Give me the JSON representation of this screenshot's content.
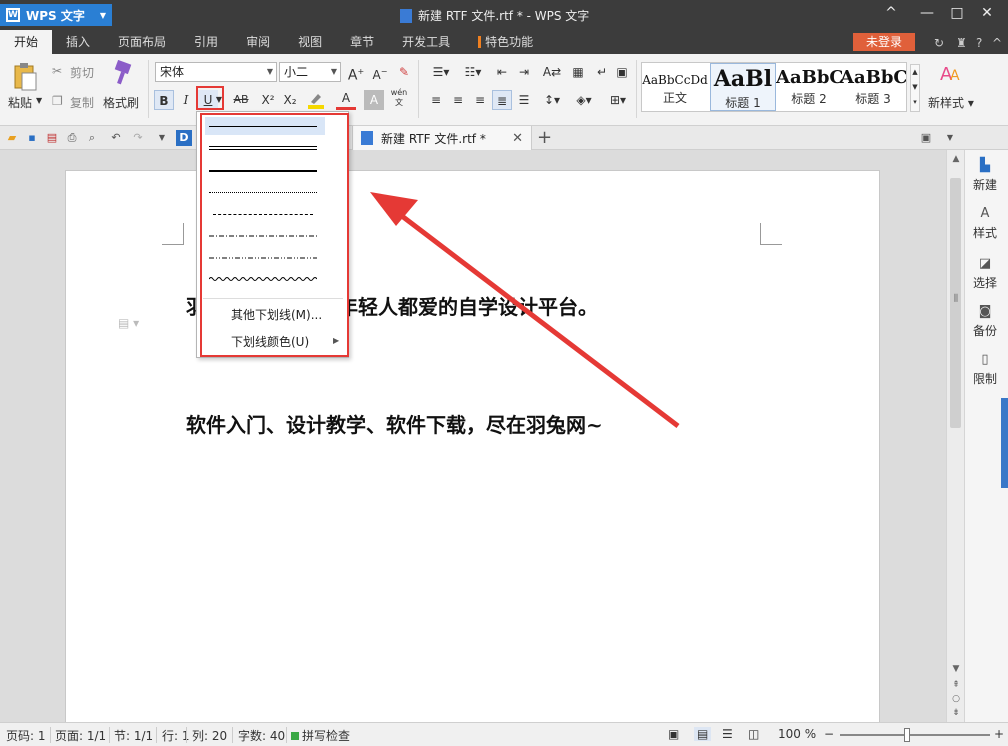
{
  "window": {
    "app_button": "WPS 文字",
    "title": "新建 RTF 文件.rtf * - WPS 文字",
    "controls": [
      "^",
      "—",
      "□",
      "✕"
    ]
  },
  "menu": {
    "items": [
      "开始",
      "插入",
      "页面布局",
      "引用",
      "审阅",
      "视图",
      "章节",
      "开发工具",
      "特色功能"
    ],
    "active": "开始",
    "login": "未登录"
  },
  "ribbon": {
    "paste": "粘贴",
    "cut": "剪切",
    "copy": "复制",
    "format_painter": "格式刷",
    "font_name": "宋体",
    "font_size": "小二",
    "bold": "B",
    "italic": "I",
    "underline": "U",
    "strike": "AB",
    "superscript": "X²",
    "subscript": "X₂",
    "font_color": "A",
    "char_shade": "A",
    "pinyin": "wén",
    "grow_font": "A⁺",
    "shrink_font": "A⁻",
    "styles": [
      {
        "sample": "AaBbCcDd",
        "name": "正文"
      },
      {
        "sample": "AaBl",
        "name": "标题 1"
      },
      {
        "sample": "AaBbC",
        "name": "标题 2"
      },
      {
        "sample": "AaBbC",
        "name": "标题 3"
      }
    ],
    "new_style": "新样式"
  },
  "tabs": {
    "doc_tab": "新建 RTF 文件.rtf *",
    "new_tab": "+"
  },
  "document": {
    "line1_visible": "羽",
    "line1_rest": "年轻人都爱的自学设计平台。",
    "line2": "软件入门、设计教学、软件下载，尽在羽兔网~"
  },
  "underline_menu": {
    "more": "其他下划线(M)...",
    "color": "下划线颜色(U)"
  },
  "right_pane": [
    {
      "icon": "new-doc-icon",
      "label": "新建"
    },
    {
      "icon": "style-icon",
      "label": "样式"
    },
    {
      "icon": "select-icon",
      "label": "选择"
    },
    {
      "icon": "backup-icon",
      "label": "备份"
    },
    {
      "icon": "restrict-icon",
      "label": "限制"
    }
  ],
  "status": {
    "page_code": "页码: 1",
    "page": "页面: 1/1",
    "section": "节: 1/1",
    "row": "行: 1",
    "col": "列: 20",
    "words": "字数: 40",
    "spell": "拼写检查",
    "zoom": "100 %"
  },
  "colors": {
    "accent_blue": "#2a7fd4",
    "highlight_red": "#e53935",
    "login_orange": "#e0603a"
  }
}
